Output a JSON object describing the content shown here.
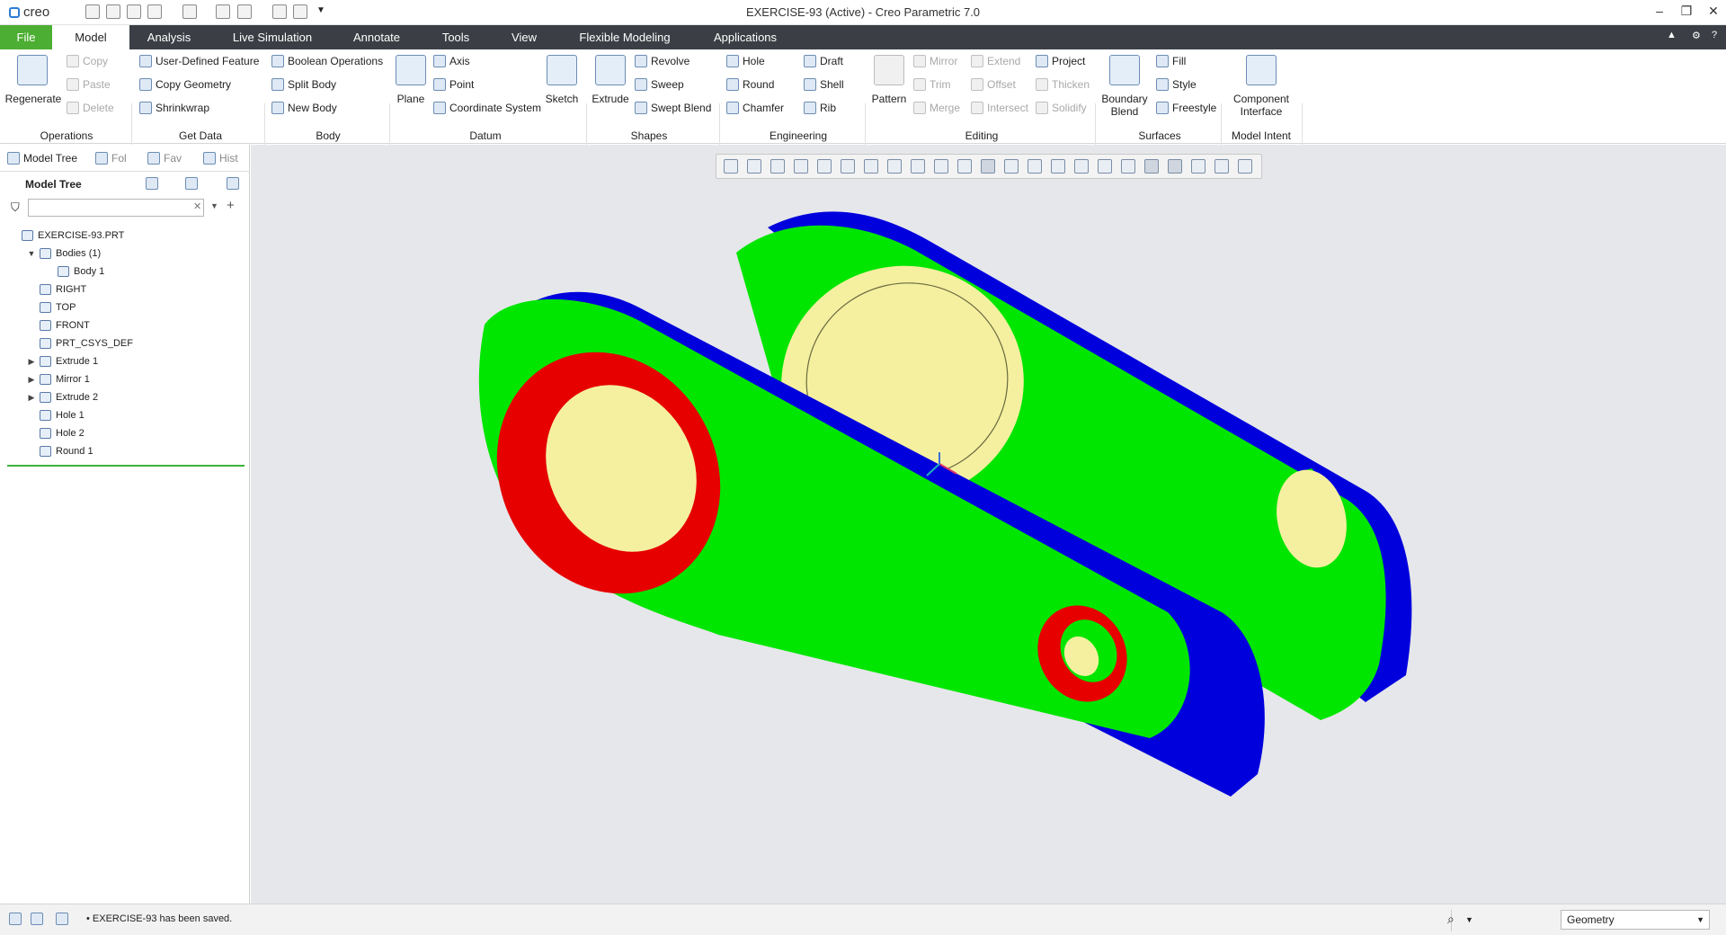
{
  "window": {
    "app_name": "creo",
    "title": "EXERCISE-93 (Active) - Creo Parametric 7.0"
  },
  "menu_tabs": [
    "File",
    "Model",
    "Analysis",
    "Live Simulation",
    "Annotate",
    "Tools",
    "View",
    "Flexible Modeling",
    "Applications"
  ],
  "active_tab": "Model",
  "ribbon": {
    "operations": {
      "regenerate": "Regenerate",
      "copy": "Copy",
      "paste": "Paste",
      "delete": "Delete",
      "group": "Operations"
    },
    "get_data": {
      "udf": "User-Defined Feature",
      "copy_geometry": "Copy Geometry",
      "shrinkwrap": "Shrinkwrap",
      "group": "Get Data"
    },
    "body": {
      "boolean": "Boolean Operations",
      "split": "Split Body",
      "new": "New Body",
      "group": "Body"
    },
    "datum": {
      "plane": "Plane",
      "axis": "Axis",
      "point": "Point",
      "csys": "Coordinate System",
      "sketch": "Sketch",
      "group": "Datum"
    },
    "shapes": {
      "extrude": "Extrude",
      "revolve": "Revolve",
      "sweep": "Sweep",
      "swept_blend": "Swept Blend",
      "group": "Shapes"
    },
    "engineering": {
      "hole": "Hole",
      "round": "Round",
      "chamfer": "Chamfer",
      "draft": "Draft",
      "shell": "Shell",
      "rib": "Rib",
      "group": "Engineering"
    },
    "editing": {
      "pattern": "Pattern",
      "mirror": "Mirror",
      "trim": "Trim",
      "merge": "Merge",
      "extend": "Extend",
      "offset": "Offset",
      "intersect": "Intersect",
      "project": "Project",
      "thicken": "Thicken",
      "solidify": "Solidify",
      "group": "Editing"
    },
    "surfaces": {
      "boundary_blend": "Boundary\nBlend",
      "fill": "Fill",
      "style": "Style",
      "freestyle": "Freestyle",
      "group": "Surfaces"
    },
    "model_intent": {
      "component_interface": "Component\nInterface",
      "group": "Model Intent"
    }
  },
  "navigator": {
    "tabs": [
      "Model Tree",
      "Fol",
      "Fav",
      "Hist"
    ],
    "header": "Model Tree",
    "search_placeholder": "",
    "tree": [
      {
        "label": "EXERCISE-93.PRT",
        "indent": 0,
        "toggle": ""
      },
      {
        "label": "Bodies (1)",
        "indent": 1,
        "toggle": "▼"
      },
      {
        "label": "Body 1",
        "indent": 2,
        "toggle": ""
      },
      {
        "label": "RIGHT",
        "indent": 1,
        "toggle": ""
      },
      {
        "label": "TOP",
        "indent": 1,
        "toggle": ""
      },
      {
        "label": "FRONT",
        "indent": 1,
        "toggle": ""
      },
      {
        "label": "PRT_CSYS_DEF",
        "indent": 1,
        "toggle": ""
      },
      {
        "label": "Extrude 1",
        "indent": 1,
        "toggle": "▶"
      },
      {
        "label": "Mirror 1",
        "indent": 1,
        "toggle": "▶"
      },
      {
        "label": "Extrude 2",
        "indent": 1,
        "toggle": "▶"
      },
      {
        "label": "Hole 1",
        "indent": 1,
        "toggle": ""
      },
      {
        "label": "Hole 2",
        "indent": 1,
        "toggle": ""
      },
      {
        "label": "Round 1",
        "indent": 1,
        "toggle": ""
      }
    ]
  },
  "model_colors": {
    "face": "#00e600",
    "side": "#0000dd",
    "boss": "#e60000",
    "bore": "#f5f0a0",
    "background": "#e6e7ea"
  },
  "status": {
    "message": "EXERCISE-93 has been saved.",
    "filter": "Geometry"
  }
}
